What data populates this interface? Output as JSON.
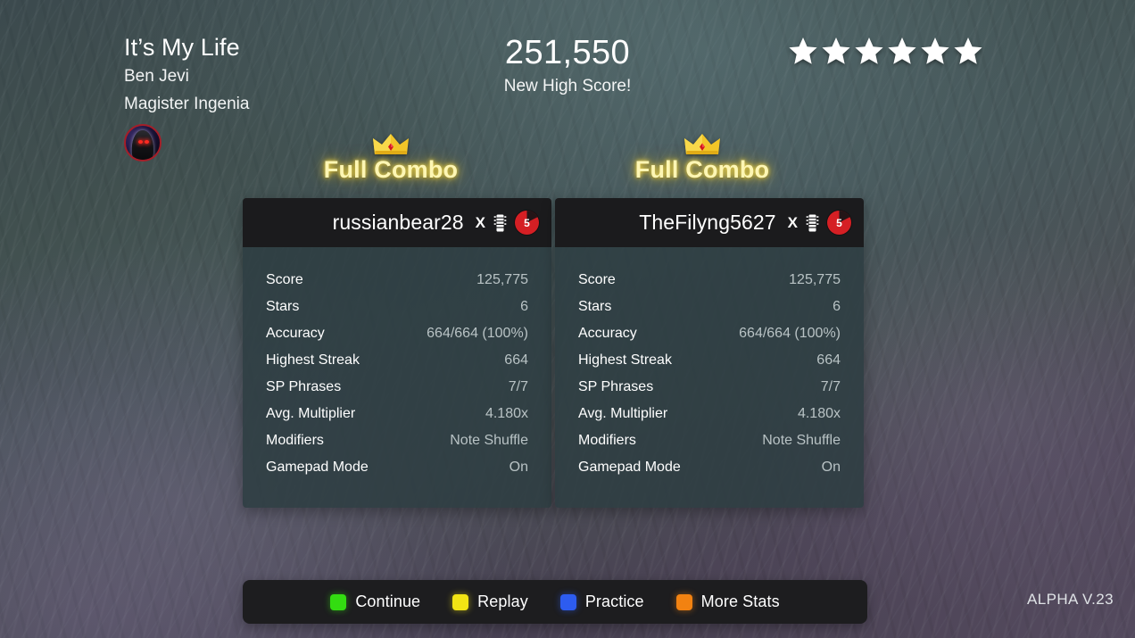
{
  "song": {
    "title": "It’s My Life",
    "artist": "Ben Jevi",
    "charter": "Magister Ingenia",
    "avatar_name": "hooded-figure-avatar"
  },
  "score": {
    "total": "251,550",
    "status": "New High Score!",
    "star_count": 6,
    "star_color": "#ffffff"
  },
  "banners": [
    {
      "text": "Full Combo",
      "icon": "crown-icon",
      "glow_color": "#ffe15a"
    },
    {
      "text": "Full Combo",
      "icon": "crown-icon",
      "glow_color": "#ffe15a"
    }
  ],
  "stat_labels": [
    "Score",
    "Stars",
    "Accuracy",
    "Highest Streak",
    "SP Phrases",
    "Avg. Multiplier",
    "Modifiers",
    "Gamepad Mode"
  ],
  "players": [
    {
      "name": "russianbear28",
      "multiplier_mark": "X",
      "instrument_icon": "guitar-fretboard-icon",
      "difficulty": "5",
      "difficulty_color": "#d51f24",
      "values": [
        "125,775",
        "6",
        "664/664 (100%)",
        "664",
        "7/7",
        "4.180x",
        "Note Shuffle",
        "On"
      ]
    },
    {
      "name": "TheFilyng5627",
      "multiplier_mark": "X",
      "instrument_icon": "guitar-fretboard-icon",
      "difficulty": "5",
      "difficulty_color": "#d51f24",
      "values": [
        "125,775",
        "6",
        "664/664 (100%)",
        "664",
        "7/7",
        "4.180x",
        "Note Shuffle",
        "On"
      ]
    }
  ],
  "buttons": [
    {
      "label": "Continue",
      "color": "#33dd11"
    },
    {
      "label": "Replay",
      "color": "#f2e414"
    },
    {
      "label": "Practice",
      "color": "#2d5cf0"
    },
    {
      "label": "More Stats",
      "color": "#f28211"
    }
  ],
  "version": "ALPHA V.23"
}
